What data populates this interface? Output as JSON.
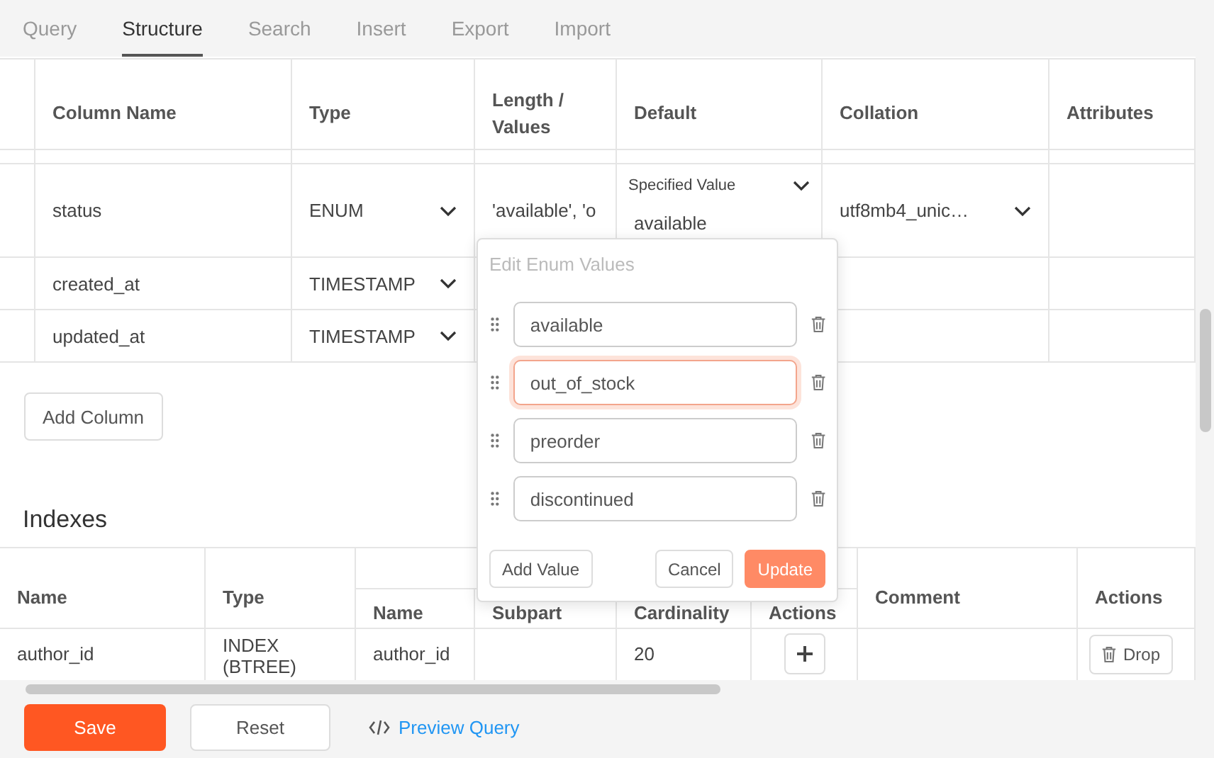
{
  "tabs": [
    {
      "label": "Query",
      "selected": false
    },
    {
      "label": "Structure",
      "selected": true
    },
    {
      "label": "Search",
      "selected": false
    },
    {
      "label": "Insert",
      "selected": false
    },
    {
      "label": "Export",
      "selected": false
    },
    {
      "label": "Import",
      "selected": false
    }
  ],
  "columns_table": {
    "columns": [
      "Column Name",
      "Type",
      "Length / Values",
      "Default",
      "Collation",
      "Attributes"
    ],
    "rows": [
      {
        "name": "status",
        "type": "ENUM",
        "length": "'available', 'o",
        "default_mode": "Specified Value",
        "default": "available",
        "collation": "utf8mb4_unic…"
      },
      {
        "name": "created_at",
        "type": "TIMESTAMP"
      },
      {
        "name": "updated_at",
        "type": "TIMESTAMP"
      }
    ]
  },
  "add_column_button": "Add Column",
  "indexes": {
    "title": "Indexes",
    "columns": [
      "Name",
      "Type"
    ],
    "subcolumns": [
      "Name",
      "Subpart",
      "Cardinality",
      "Actions"
    ],
    "columns_after": [
      "Comment",
      "Actions"
    ],
    "rows": [
      {
        "name": "author_id",
        "type": "INDEX (BTREE)",
        "column": "author_id",
        "cardinality": "20",
        "drop": "Drop"
      }
    ]
  },
  "enum_popup": {
    "title": "Edit Enum Values",
    "values": [
      {
        "value": "available",
        "focused": false
      },
      {
        "value": "out_of_stock",
        "focused": true
      },
      {
        "value": "preorder",
        "focused": false
      },
      {
        "value": "discontinued",
        "focused": false
      }
    ],
    "add_button": "Add Value",
    "cancel_button": "Cancel",
    "update_button": "Update"
  },
  "footer": {
    "save": "Save",
    "reset": "Reset",
    "preview": "Preview Query"
  }
}
